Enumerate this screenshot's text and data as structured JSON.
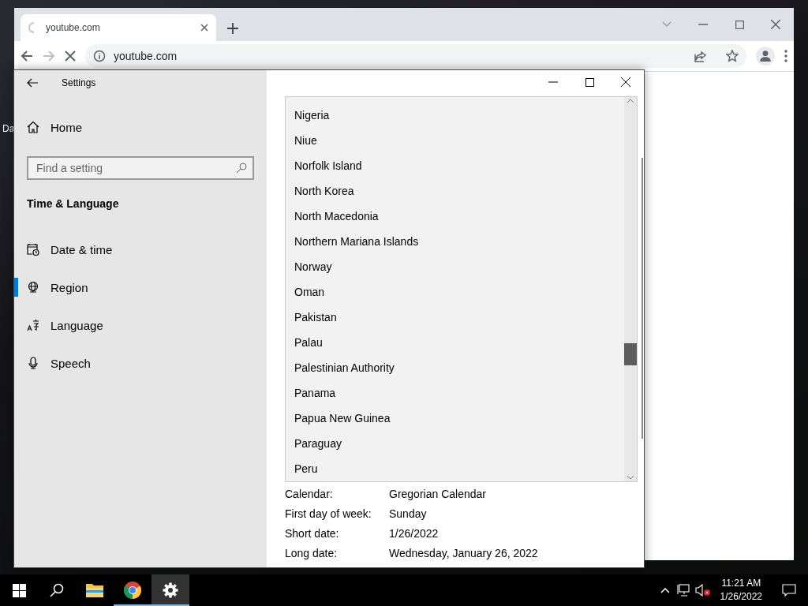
{
  "desktop": {
    "icon_label": "Da"
  },
  "browser": {
    "loading": true,
    "tabs": [
      {
        "title": "youtube.com",
        "selected": true
      }
    ],
    "address": "youtube.com"
  },
  "settings": {
    "title": "Settings",
    "home": "Home",
    "search": {
      "placeholder": "Find a setting"
    },
    "section": "Time & Language",
    "nav": [
      {
        "label": "Date & time",
        "kind": "calendar",
        "selected": false
      },
      {
        "label": "Region",
        "kind": "globe",
        "selected": true
      },
      {
        "label": "Language",
        "kind": "language",
        "selected": false
      },
      {
        "label": "Speech",
        "kind": "mic",
        "selected": false
      }
    ],
    "countries": [
      "Nigeria",
      "Niue",
      "Norfolk Island",
      "North Korea",
      "North Macedonia",
      "Northern Mariana Islands",
      "Norway",
      "Oman",
      "Pakistan",
      "Palau",
      "Palestinian Authority",
      "Panama",
      "Papua New Guinea",
      "Paraguay",
      "Peru"
    ],
    "details": [
      {
        "label": "Calendar:",
        "value": "Gregorian Calendar"
      },
      {
        "label": "First day of week:",
        "value": "Sunday"
      },
      {
        "label": "Short date:",
        "value": "1/26/2022"
      },
      {
        "label": "Long date:",
        "value": "Wednesday, January 26, 2022"
      }
    ]
  },
  "taskbar": {
    "apps": [
      {
        "kind": "explorer",
        "open": false,
        "active": false
      },
      {
        "kind": "chrome",
        "open": true,
        "active": false
      },
      {
        "kind": "settings",
        "open": true,
        "active": true
      }
    ],
    "time": "11:21 AM",
    "date": "1/26/2022"
  }
}
